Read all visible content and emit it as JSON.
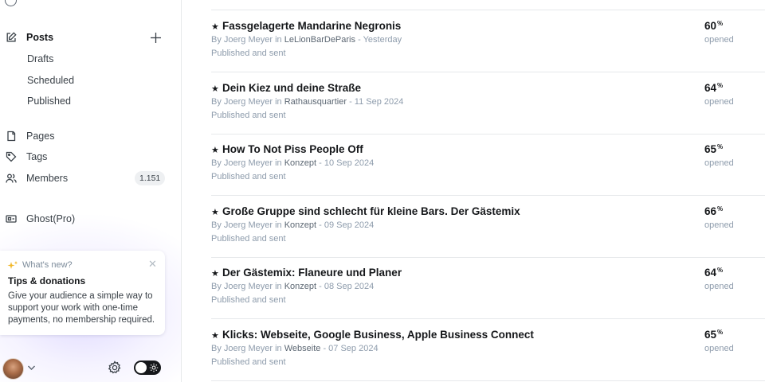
{
  "sidebar": {
    "posts": {
      "label": "Posts",
      "children": [
        {
          "label": "Drafts"
        },
        {
          "label": "Scheduled"
        },
        {
          "label": "Published"
        }
      ]
    },
    "pages": {
      "label": "Pages"
    },
    "tags": {
      "label": "Tags"
    },
    "members": {
      "label": "Members",
      "count": "1.151"
    },
    "ghost_pro": {
      "label": "Ghost(Pro)"
    },
    "whats_new": {
      "eyebrow": "What's new?",
      "title": "Tips & donations",
      "body": "Give your audience a simple way to support your work with one-time payments, no membership required."
    },
    "footer": {
      "theme_toggle": "dark-mode-off"
    }
  },
  "posts": [
    {
      "title": "Fassgelagerte Mandarine Negronis",
      "author": "By Joerg Meyer",
      "tag": "LeLionBarDeParis",
      "date": "Yesterday",
      "status": "Published and sent",
      "open_rate": "60",
      "stat_label": "opened"
    },
    {
      "title": "Dein Kiez und deine Straße",
      "author": "By Joerg Meyer",
      "tag": "Rathausquartier",
      "date": "11 Sep 2024",
      "status": "Published and sent",
      "open_rate": "64",
      "stat_label": "opened"
    },
    {
      "title": "How To Not Piss People Off",
      "author": "By Joerg Meyer",
      "tag": "Konzept",
      "date": "10 Sep 2024",
      "status": "Published and sent",
      "open_rate": "65",
      "stat_label": "opened"
    },
    {
      "title": "Große Gruppe sind schlecht für kleine Bars. Der Gästemix",
      "author": "By Joerg Meyer",
      "tag": "Konzept",
      "date": "09 Sep 2024",
      "status": "Published and sent",
      "open_rate": "66",
      "stat_label": "opened"
    },
    {
      "title": "Der Gästemix: Flaneure und Planer",
      "author": "By Joerg Meyer",
      "tag": "Konzept",
      "date": "08 Sep 2024",
      "status": "Published and sent",
      "open_rate": "64",
      "stat_label": "opened"
    },
    {
      "title": "Klicks: Webseite, Google Business, Apple Business Connect",
      "author": "By Joerg Meyer",
      "tag": "Webseite",
      "date": "07 Sep 2024",
      "status": "Published and sent",
      "open_rate": "65",
      "stat_label": "opened"
    }
  ],
  "labels": {
    "in": "in",
    "separator": "-",
    "percent": "%"
  },
  "icons": [
    "pencil-square-icon",
    "plus-icon",
    "page-icon",
    "tag-icon",
    "members-icon",
    "ghost-pro-icon",
    "sparkle-icon",
    "close-icon",
    "chevron-down-icon",
    "gear-icon",
    "sun-icon",
    "star-icon"
  ]
}
